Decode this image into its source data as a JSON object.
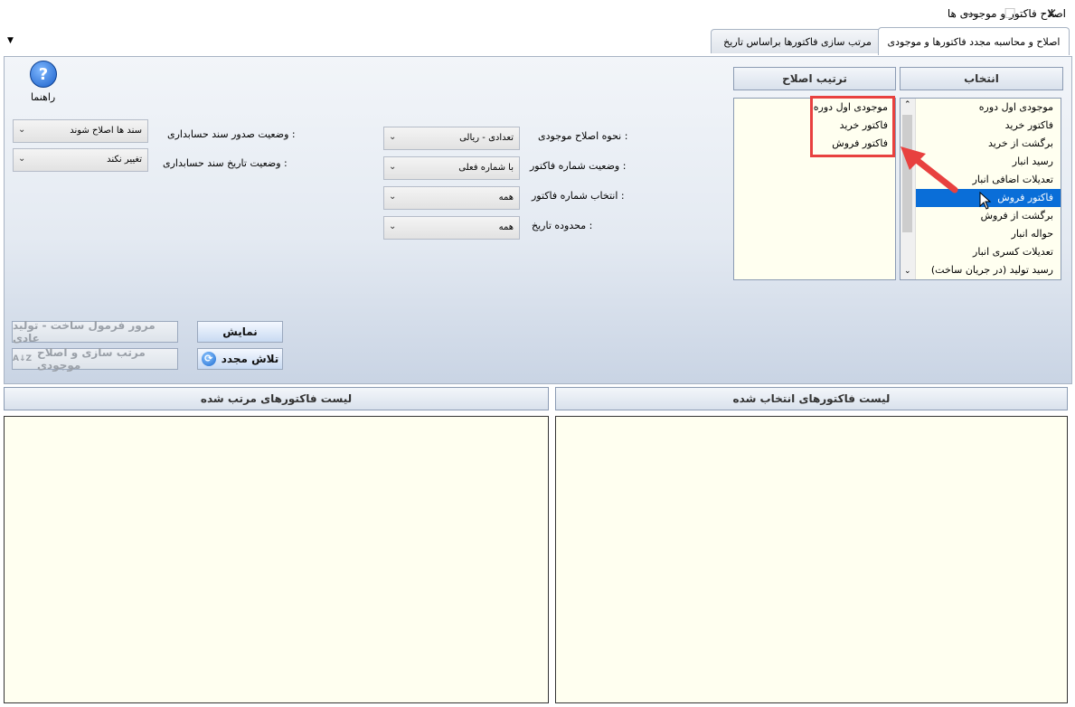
{
  "window": {
    "title": "اصلاح فاکتور و موجودی ها",
    "minimize": "—",
    "maximize": "☐",
    "close": "✕"
  },
  "tabs": [
    {
      "label": "اصلاح و محاسبه مجدد فاکتورها و موجودی",
      "active": true
    },
    {
      "label": "مرتب سازی فاکتورها براساس تاریخ",
      "active": false
    }
  ],
  "help": {
    "label": "راهنما"
  },
  "selection": {
    "header": "انتخاب",
    "items": [
      "موجودی اول دوره",
      "فاکتور خرید",
      "برگشت از خرید",
      "رسید انبار",
      "تعدیلات اضافی انبار",
      "فاکتور فروش",
      "برگشت از فروش",
      "حواله انبار",
      "تعدیلات کسری انبار",
      "رسید تولید (در جریان ساخت)"
    ],
    "selected": "فاکتور فروش"
  },
  "order": {
    "header": "ترتیب اصلاح",
    "items": [
      "موجودی اول دوره",
      "فاکتور خرید",
      "فاکتور فروش"
    ]
  },
  "fields": {
    "fix_method": {
      "label": "نحوه اصلاح موجودی :",
      "value": "تعدادی - ریالی"
    },
    "invoice_number_status": {
      "label": "وضعیت شماره فاکتور :",
      "value": "با شماره فعلی"
    },
    "invoice_number_select": {
      "label": "انتخاب شماره فاکتور :",
      "value": "همه"
    },
    "date_range": {
      "label": "محدوده تاریخ :",
      "value": "همه"
    },
    "voucher_issue_status": {
      "label": "وضعیت صدور سند حسابداری :",
      "value": "سند ها اصلاح شوند"
    },
    "voucher_date_status": {
      "label": "وضعیت تاریخ سند حسابداری :",
      "value": "تغییر نکند"
    }
  },
  "buttons": {
    "show": "نمایش",
    "retry": "تلاش مجدد",
    "review_formula": "مرور فرمول ساخت - تولید عادی",
    "sort_fix_inventory": "مرتب سازی و اصلاح موجودی"
  },
  "bottom": {
    "selected_invoices": "لیست فاکتورهای انتخاب شده",
    "sorted_invoices": "لیست فاکتورهای مرتب شده"
  },
  "colors": {
    "selection_highlight": "#0a6ed8",
    "annotation_red": "#e8413f",
    "list_bg": "#fffff0"
  }
}
